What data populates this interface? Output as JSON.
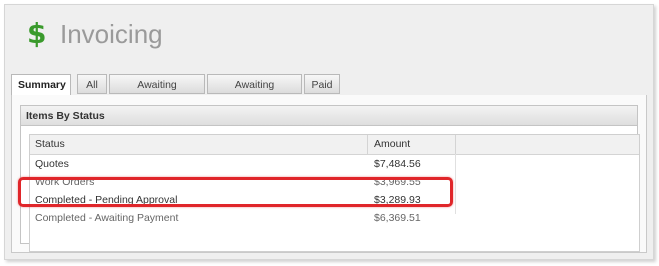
{
  "app": {
    "title": "Invoicing",
    "icon": "dollar-icon",
    "accent": "#3a9a2c"
  },
  "tabs": [
    {
      "label": "Summary",
      "active": true
    },
    {
      "label": "All"
    },
    {
      "label": "Awaiting Approval"
    },
    {
      "label": "Awaiting Payment"
    },
    {
      "label": "Paid"
    }
  ],
  "panel": {
    "title": "Items By Status"
  },
  "table": {
    "columns": [
      "Status",
      "Amount"
    ],
    "rows": [
      {
        "status": "Quotes",
        "amount": "$7,484.56"
      },
      {
        "status": "Work Orders",
        "amount": "$3,969.55"
      },
      {
        "status": "Completed - Pending Approval",
        "amount": "$3,289.93"
      },
      {
        "status": "Completed - Awaiting Payment",
        "amount": "$6,369.51"
      }
    ]
  },
  "highlight": {
    "color": "#e0262a"
  }
}
